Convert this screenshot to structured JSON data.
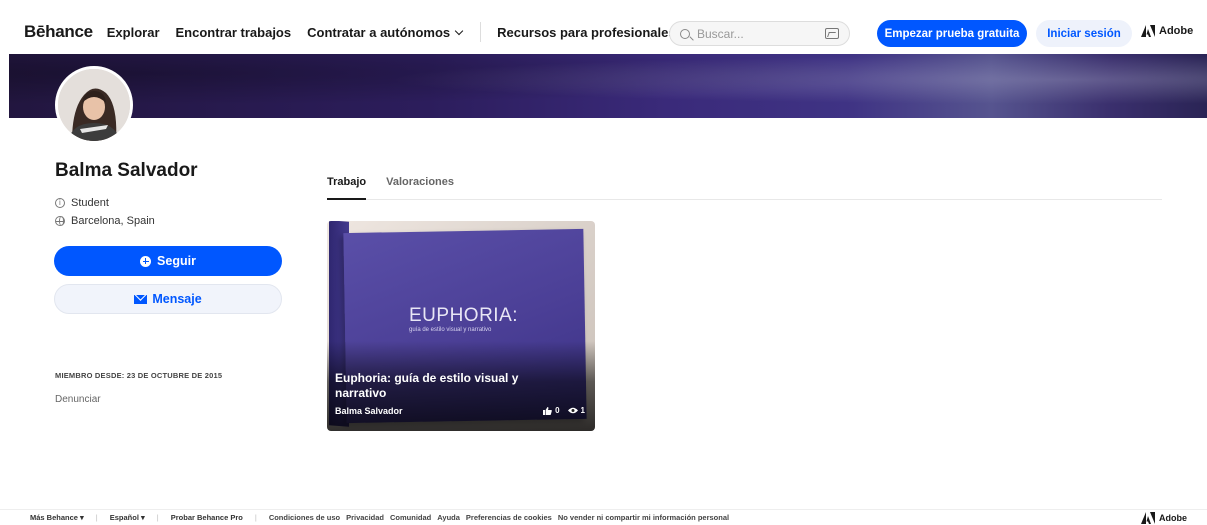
{
  "nav": {
    "logo": "Bēhance",
    "links": [
      "Explorar",
      "Encontrar trabajos",
      "Contratar a autónomos",
      "Recursos para profesionales"
    ],
    "search_placeholder": "Buscar...",
    "trial_button": "Empezar prueba gratuita",
    "login_button": "Iniciar sesión",
    "adobe": "Adobe"
  },
  "colors": {
    "accent": "#0057ff",
    "banner_dark": "#22163f",
    "banner_light": "#56548f"
  },
  "profile": {
    "name": "Balma Salvador",
    "occupation": "Student",
    "location": "Barcelona, Spain",
    "follow_button": "Seguir",
    "message_button": "Mensaje",
    "member_since": "MIEMBRO DESDE: 23 DE OCTUBRE DE 2015",
    "report": "Denunciar"
  },
  "tabs": [
    "Trabajo",
    "Valoraciones"
  ],
  "project": {
    "cover_title": "EUPHORIA:",
    "cover_subtitle": "guía de estilo visual y narrativo",
    "title": "Euphoria: guía de estilo visual y narrativo",
    "owner": "Balma Salvador",
    "likes": "0",
    "views": "1"
  },
  "footer": {
    "more": "Más Behance",
    "language": "Español",
    "try_pro": "Probar Behance Pro",
    "links": [
      "Condiciones de uso",
      "Privacidad",
      "Comunidad",
      "Ayuda",
      "Preferencias de cookies",
      "No vender ni compartir mi información personal"
    ],
    "adobe": "Adobe"
  }
}
